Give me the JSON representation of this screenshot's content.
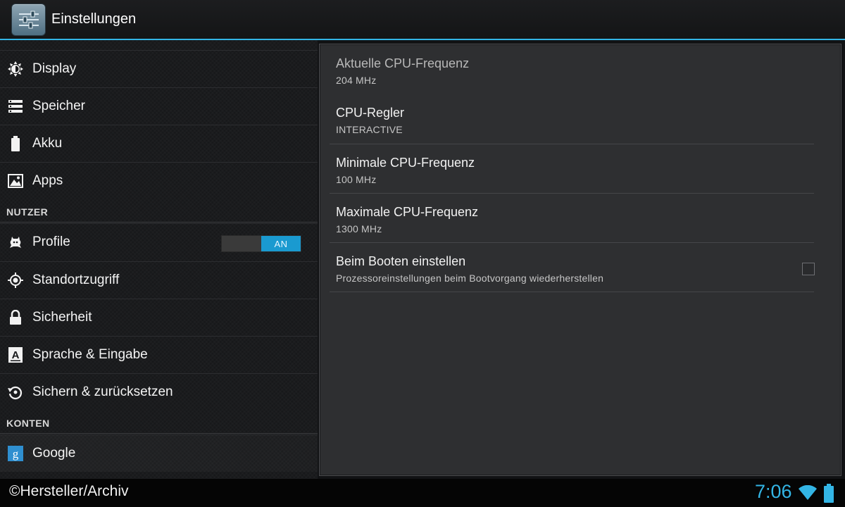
{
  "actionbar": {
    "title": "Einstellungen",
    "icon": "settings-sliders-icon"
  },
  "sidebar": {
    "items": [
      {
        "label": "Display",
        "icon": "brightness-icon"
      },
      {
        "label": "Speicher",
        "icon": "storage-icon"
      },
      {
        "label": "Akku",
        "icon": "battery-icon"
      },
      {
        "label": "Apps",
        "icon": "apps-icon"
      },
      {
        "label": "Profile",
        "icon": "profile-icon"
      },
      {
        "label": "Standortzugriff",
        "icon": "location-icon"
      },
      {
        "label": "Sicherheit",
        "icon": "lock-icon"
      },
      {
        "label": "Sprache & Eingabe",
        "icon": "language-icon"
      },
      {
        "label": "Sichern & zurücksetzen",
        "icon": "backup-icon"
      },
      {
        "label": "Google",
        "icon": "google-icon"
      }
    ],
    "headers": {
      "nutzer": "NUTZER",
      "konten": "KONTEN"
    },
    "profile_toggle": {
      "label": "AN",
      "state": "on",
      "color": "#1a9ad0"
    }
  },
  "preferences": [
    {
      "title": "Aktuelle CPU-Frequenz",
      "summary": "204 MHz",
      "enabled": false
    },
    {
      "title": "CPU-Regler",
      "summary": "INTERACTIVE",
      "enabled": true
    },
    {
      "title": "Minimale CPU-Frequenz",
      "summary": "100 MHz",
      "enabled": true
    },
    {
      "title": "Maximale CPU-Frequenz",
      "summary": "1300 MHz",
      "enabled": true
    },
    {
      "title": "Beim Booten einstellen",
      "summary": "Prozessoreinstellungen beim Bootvorgang wiederherstellen",
      "enabled": true,
      "checked": false
    }
  ],
  "systembar": {
    "watermark": "©Hersteller/Archiv",
    "time": "7:06",
    "accent": "#33b5e5"
  }
}
